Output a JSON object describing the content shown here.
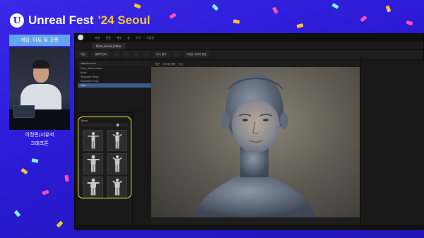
{
  "event": {
    "title_main": "Unreal Fest",
    "title_accent": "'24 Seoul",
    "logo_glyph": "U",
    "accent_color": "#f3c431",
    "bg_color": "#2a1ad4"
  },
  "session": {
    "tag": "게임: 아트 및 공통",
    "speaker_name": "이정민/서유석",
    "speaker_org": "크래프톤"
  },
  "editor": {
    "menu": [
      "파일",
      "편집",
      "에셋",
      "창",
      "도구",
      "도움말"
    ],
    "doc_tab": "Male_Head_Editor",
    "toolbar": [
      "저장",
      "블루프린트",
      "",
      "",
      "",
      "",
      "메시 빌드",
      "",
      "고정된 아바타 편집"
    ],
    "outliner_title": "MetaHuman",
    "outliner_rows": [
      "Male_Head_Editor",
      "Body",
      "Template Mesh",
      "Essential Props",
      "Hair"
    ],
    "outliner_selected_index": 4,
    "body_panel_title": "Body",
    "body_thumbs": 6,
    "viewport_tab": "원근",
    "viewport_menu": [
      "원근",
      "라이팅 포함",
      "표시",
      "",
      "",
      "",
      "",
      ""
    ],
    "status": ""
  }
}
